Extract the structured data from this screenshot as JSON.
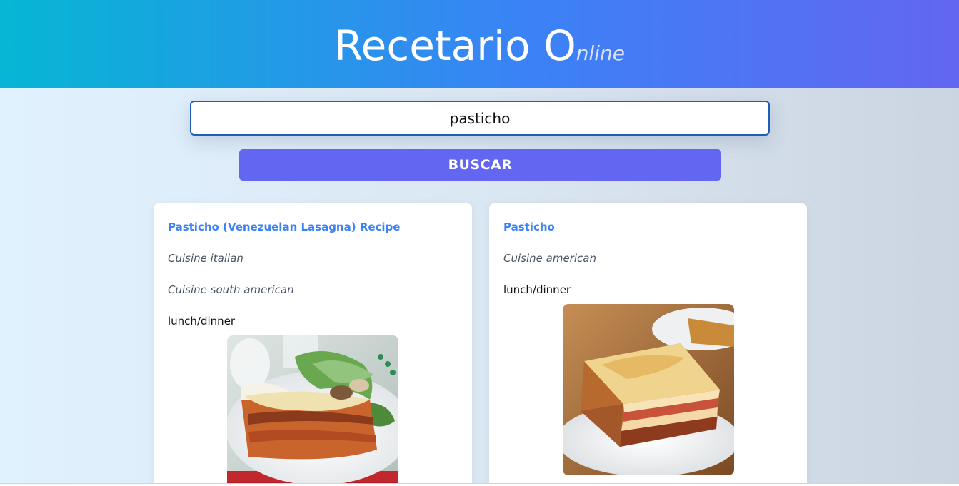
{
  "header": {
    "title_main": "Recetario O",
    "title_small": "nline"
  },
  "search": {
    "value": "pasticho",
    "placeholder": "",
    "button_label": "BUSCAR"
  },
  "results": [
    {
      "title": "Pasticho (Venezuelan Lasagna) Recipe",
      "cuisines": [
        "Cuisine italian",
        "Cuisine south american"
      ],
      "meal_type": "lunch/dinner",
      "image": "lasagna-plate-salad-photo"
    },
    {
      "title": "Pasticho",
      "cuisines": [
        "Cuisine american"
      ],
      "meal_type": "lunch/dinner",
      "image": "lasagna-slice-plate-photo"
    }
  ],
  "colors": {
    "header_start": "#06b6d4",
    "header_end": "#6366f1",
    "button": "#6366f1",
    "link": "#3b82f6",
    "input_border": "#1d5fb8"
  }
}
